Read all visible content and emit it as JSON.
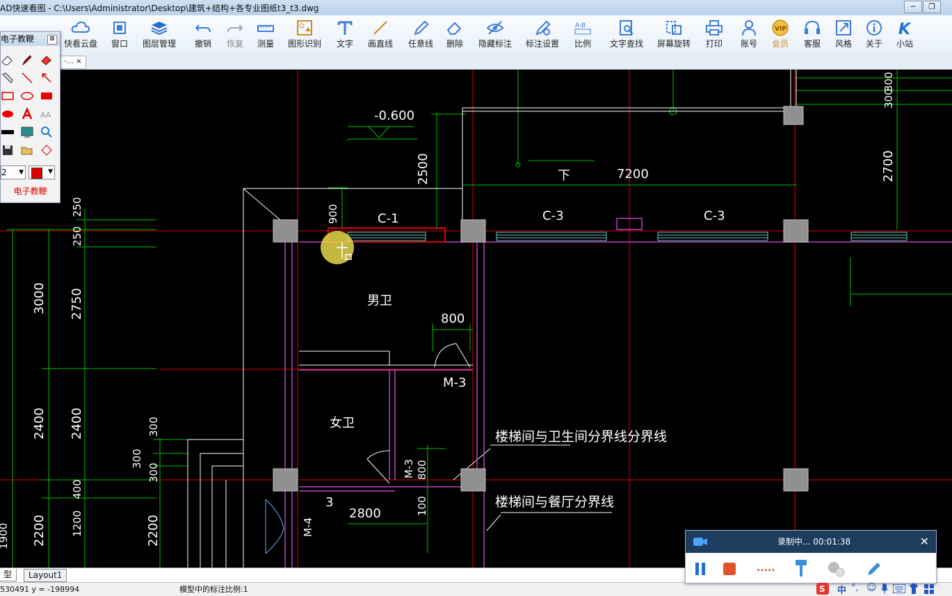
{
  "window": {
    "title": "AD快速看图 - C:\\Users\\Administrator\\Desktop\\建筑+结构+各专业图纸t3_t3.dwg",
    "minimize": "─",
    "maximize": "❐"
  },
  "toolbar": {
    "items": [
      {
        "label": "快看云盘",
        "icon": "cloud-icon"
      },
      {
        "label": "窗口",
        "icon": "window-icon"
      },
      {
        "label": "图层管理",
        "icon": "layers-icon"
      },
      {
        "label": "撤销",
        "icon": "undo-icon"
      },
      {
        "label": "恢复",
        "icon": "redo-icon"
      },
      {
        "label": "测量",
        "icon": "ruler-icon"
      },
      {
        "label": "图形识别",
        "icon": "shape-recognize-icon"
      },
      {
        "label": "文字",
        "icon": "text-icon"
      },
      {
        "label": "画直线",
        "icon": "line-icon"
      },
      {
        "label": "任意线",
        "icon": "pen-icon"
      },
      {
        "label": "删除",
        "icon": "eraser-icon"
      },
      {
        "label": "隐藏标注",
        "icon": "hide-eye-icon"
      },
      {
        "label": "标注设置",
        "icon": "annotation-settings-icon"
      },
      {
        "label": "比例",
        "icon": "scale-icon"
      },
      {
        "label": "文字查找",
        "icon": "text-search-icon"
      },
      {
        "label": "屏幕旋转",
        "icon": "rotate-icon"
      },
      {
        "label": "打印",
        "icon": "printer-icon"
      },
      {
        "label": "账号",
        "icon": "user-icon"
      },
      {
        "label": "会员",
        "icon": "vip-icon"
      },
      {
        "label": "客服",
        "icon": "headset-icon"
      },
      {
        "label": "风格",
        "icon": "style-icon"
      },
      {
        "label": "关于",
        "icon": "info-icon"
      },
      {
        "label": "小站",
        "icon": "k-logo-icon"
      }
    ]
  },
  "palette": {
    "title": "电子教鞭",
    "close": "⊠",
    "line_width": "2",
    "footer": "电子教鞭",
    "color": "#e00000"
  },
  "drawing": {
    "tab_label": "-…",
    "texts": {
      "elev": "-0.600",
      "d2500": "2500",
      "d900": "900",
      "c1": "C-1",
      "c3a": "C-3",
      "c3b": "C-3",
      "down": "下",
      "d7200": "7200",
      "d300a": "300",
      "d300b": "300",
      "d2700": "2700",
      "d250a": "250",
      "d250b": "250",
      "d3000": "3000",
      "d2750": "2750",
      "men": "男卫",
      "d800": "800",
      "m3a": "M-3",
      "women": "女卫",
      "d2400a": "2400",
      "d2400b": "2400",
      "d300c": "300",
      "d300d": "300",
      "d300e": "300",
      "note1": "楼梯间与卫生间分界线分界线",
      "note2": "楼梯间与餐厅分界线",
      "m3b": "M-3",
      "d800b": "800",
      "three": "3",
      "d2800": "2800",
      "d100": "100",
      "d400": "400",
      "d2200a": "2200",
      "d1200": "1200",
      "d2200b": "2200",
      "m4": "M-4",
      "d1900": "1900"
    }
  },
  "layout_tabs": [
    "型",
    "Layout1"
  ],
  "status": {
    "coords": "530491 y = -198994",
    "scale_text": "模型中的标注比例:1"
  },
  "recorder": {
    "status": "录制中... 00:01:38",
    "close": "✕",
    "dots": "....."
  },
  "tray": {
    "ime": "中",
    "punct": "°,"
  },
  "colors": {
    "axis_red": "#e00000",
    "dim_green": "#00c000",
    "wall_white": "#ffffff",
    "wall_magenta": "#c040c0",
    "column_gray": "#909090",
    "window_cyan": "#66cccc",
    "cursor_yellow": "#e8d84a"
  }
}
